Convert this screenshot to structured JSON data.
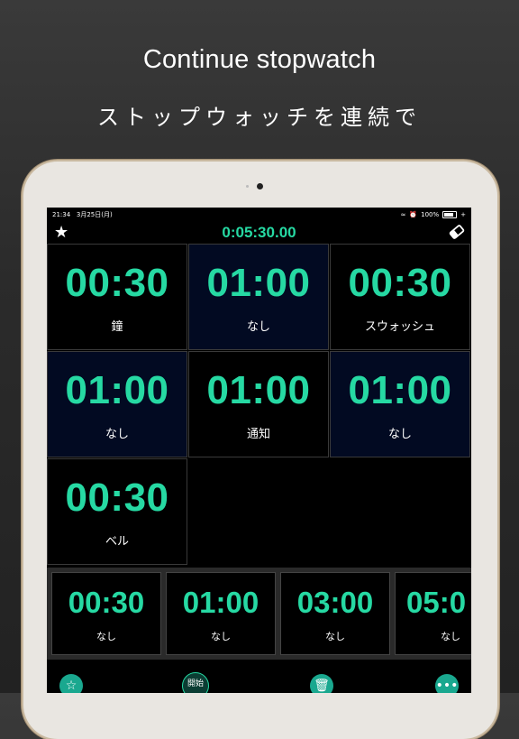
{
  "headline": {
    "title": "Continue stopwatch",
    "subtitle": "ストップウォッチを連続で"
  },
  "statusbar": {
    "time": "21:34",
    "date": "3月25日(月)",
    "battery": "100%"
  },
  "navbar": {
    "total_time": "0:05:30.00",
    "left_icon": "star-icon",
    "right_icon": "eraser-icon"
  },
  "timers": [
    {
      "time": "00:30",
      "sound": "鐘",
      "bg": "black"
    },
    {
      "time": "01:00",
      "sound": "なし",
      "bg": "blue"
    },
    {
      "time": "00:30",
      "sound": "スウォッシュ",
      "bg": "black"
    },
    {
      "time": "01:00",
      "sound": "なし",
      "bg": "blue"
    },
    {
      "time": "01:00",
      "sound": "通知",
      "bg": "black"
    },
    {
      "time": "01:00",
      "sound": "なし",
      "bg": "blue"
    },
    {
      "time": "00:30",
      "sound": "ベル",
      "bg": "black"
    }
  ],
  "presets": [
    {
      "time": "00:30",
      "sound": "なし"
    },
    {
      "time": "01:00",
      "sound": "なし"
    },
    {
      "time": "03:00",
      "sound": "なし"
    },
    {
      "time": "05:0",
      "sound": "なし"
    }
  ],
  "toolbar": {
    "favorite_icon": "star-icon",
    "start_label": "開始",
    "delete_icon": "trash-icon",
    "more_icon": "more-icon"
  },
  "colors": {
    "accent": "#26d9a3",
    "blue_cell": "#020a22"
  }
}
